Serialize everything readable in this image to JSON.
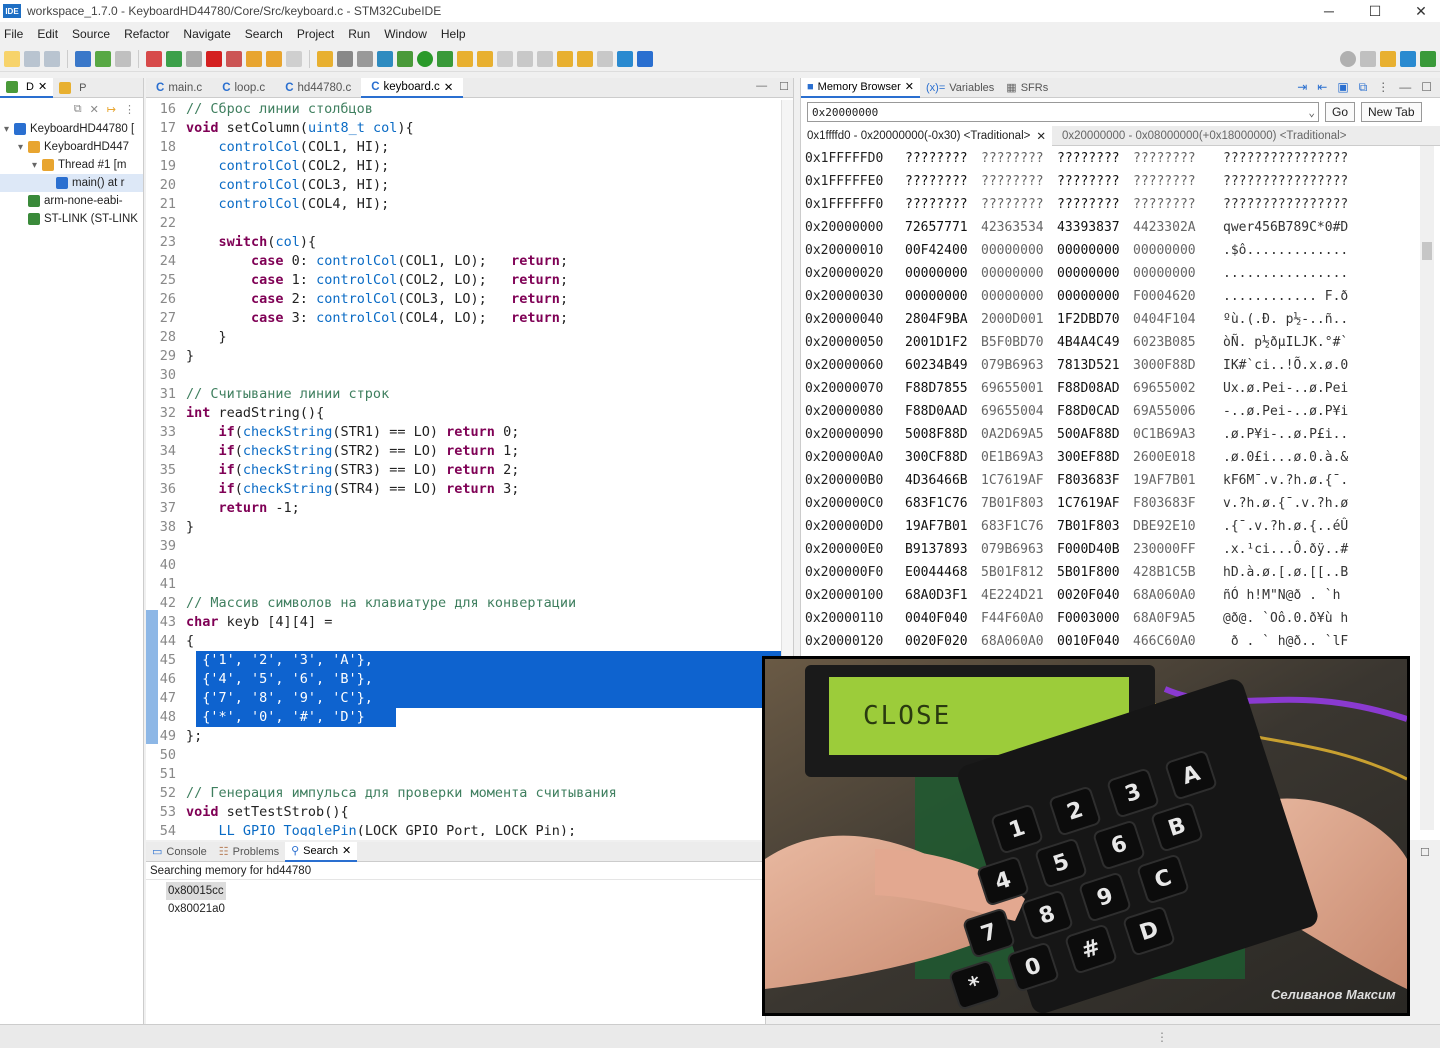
{
  "window": {
    "title": "workspace_1.7.0 - KeyboardHD44780/Core/Src/keyboard.c - STM32CubeIDE",
    "app_icon": "IDE",
    "minimize": "─",
    "maximize": "☐",
    "close": "✕"
  },
  "menu": [
    "File",
    "Edit",
    "Source",
    "Refactor",
    "Navigate",
    "Search",
    "Project",
    "Run",
    "Window",
    "Help"
  ],
  "left_panel": {
    "tabs": [
      {
        "label": "D"
      },
      {
        "label": "P"
      }
    ],
    "tree": [
      {
        "label": "KeyboardHD44780 [",
        "indent": 0
      },
      {
        "label": "KeyboardHD447",
        "indent": 1
      },
      {
        "label": "Thread #1 [m",
        "indent": 2
      },
      {
        "label": "main() at r",
        "indent": 3
      },
      {
        "label": "arm-none-eabi-",
        "indent": 1
      },
      {
        "label": "ST-LINK (ST-LINK",
        "indent": 1
      }
    ]
  },
  "editor": {
    "tabs": [
      {
        "label": "main.c",
        "active": false
      },
      {
        "label": "loop.c",
        "active": false
      },
      {
        "label": "hd44780.c",
        "active": false
      },
      {
        "label": "keyboard.c",
        "active": true
      }
    ],
    "lines": [
      {
        "n": "16",
        "text": "// Сброс линии столбцов",
        "type": "comment"
      },
      {
        "n": "17",
        "text": "void setColumn(uint8_t col){",
        "type": "code"
      },
      {
        "n": "18",
        "text": "    controlCol(COL1, HI);",
        "type": "code"
      },
      {
        "n": "19",
        "text": "    controlCol(COL2, HI);",
        "type": "code"
      },
      {
        "n": "20",
        "text": "    controlCol(COL3, HI);",
        "type": "code"
      },
      {
        "n": "21",
        "text": "    controlCol(COL4, HI);",
        "type": "code"
      },
      {
        "n": "22",
        "text": "",
        "type": "code"
      },
      {
        "n": "23",
        "text": "    switch(col){",
        "type": "code"
      },
      {
        "n": "24",
        "text": "        case 0: controlCol(COL1, LO);   return;",
        "type": "code"
      },
      {
        "n": "25",
        "text": "        case 1: controlCol(COL2, LO);   return;",
        "type": "code"
      },
      {
        "n": "26",
        "text": "        case 2: controlCol(COL3, LO);   return;",
        "type": "code"
      },
      {
        "n": "27",
        "text": "        case 3: controlCol(COL4, LO);   return;",
        "type": "code"
      },
      {
        "n": "28",
        "text": "    }",
        "type": "code"
      },
      {
        "n": "29",
        "text": "}",
        "type": "code"
      },
      {
        "n": "30",
        "text": "",
        "type": "code"
      },
      {
        "n": "31",
        "text": "// Считывание линии строк",
        "type": "comment"
      },
      {
        "n": "32",
        "text": "int readString(){",
        "type": "code"
      },
      {
        "n": "33",
        "text": "    if(checkString(STR1) == LO) return 0;",
        "type": "code"
      },
      {
        "n": "34",
        "text": "    if(checkString(STR2) == LO) return 1;",
        "type": "code"
      },
      {
        "n": "35",
        "text": "    if(checkString(STR3) == LO) return 2;",
        "type": "code"
      },
      {
        "n": "36",
        "text": "    if(checkString(STR4) == LO) return 3;",
        "type": "code"
      },
      {
        "n": "37",
        "text": "    return -1;",
        "type": "code"
      },
      {
        "n": "38",
        "text": "}",
        "type": "code"
      },
      {
        "n": "39",
        "text": "",
        "type": "code"
      },
      {
        "n": "40",
        "text": "",
        "type": "code"
      },
      {
        "n": "41",
        "text": "",
        "type": "code"
      },
      {
        "n": "42",
        "text": "// Массив символов на клавиатуре для конвертации",
        "type": "comment"
      },
      {
        "n": "43",
        "text": "char keyb [4][4] =",
        "type": "code"
      },
      {
        "n": "44",
        "text": "{",
        "type": "code"
      },
      {
        "n": "45",
        "text": "  {'1', '2', '3', 'A'},",
        "type": "selected"
      },
      {
        "n": "46",
        "text": "  {'4', '5', '6', 'B'},",
        "type": "selected"
      },
      {
        "n": "47",
        "text": "  {'7', '8', '9', 'C'},",
        "type": "selected"
      },
      {
        "n": "48",
        "text": "  {'*', '0', '#', 'D'}",
        "type": "selected"
      },
      {
        "n": "49",
        "text": "};",
        "type": "code"
      },
      {
        "n": "50",
        "text": "",
        "type": "code"
      },
      {
        "n": "51",
        "text": "",
        "type": "code"
      },
      {
        "n": "52",
        "text": "// Генерация импульса для проверки момента считывания",
        "type": "comment"
      },
      {
        "n": "53",
        "text": "void setTestStrob(){",
        "type": "code"
      },
      {
        "n": "54",
        "text": "    LL_GPIO_TogglePin(LOCK_GPIO_Port, LOCK_Pin);",
        "type": "code"
      }
    ]
  },
  "memory": {
    "tabs": [
      {
        "label": "Memory Browser"
      },
      {
        "label": "Variables"
      },
      {
        "label": "SFRs"
      }
    ],
    "address_input": "0x20000000",
    "go_label": "Go",
    "new_tab_label": "New Tab",
    "rendering_tabs": [
      {
        "label": "0x1ffffd0 - 0x20000000(-0x30) <Traditional>"
      },
      {
        "label": "0x20000000 - 0x08000000(+0x18000000) <Traditional>"
      }
    ],
    "rows": [
      {
        "addr": "0x1FFFFFD0",
        "w": [
          "????????",
          "????????",
          "????????",
          "????????"
        ],
        "ascii": "????????????????"
      },
      {
        "addr": "0x1FFFFFE0",
        "w": [
          "????????",
          "????????",
          "????????",
          "????????"
        ],
        "ascii": "????????????????"
      },
      {
        "addr": "0x1FFFFFF0",
        "w": [
          "????????",
          "????????",
          "????????",
          "????????"
        ],
        "ascii": "????????????????"
      },
      {
        "addr": "0x20000000",
        "w": [
          "72657771",
          "42363534",
          "43393837",
          "4423302A"
        ],
        "ascii": "qwer456B789C*0#D"
      },
      {
        "addr": "0x20000010",
        "w": [
          "00F42400",
          "00000000",
          "00000000",
          "00000000"
        ],
        "ascii": ".$ô............."
      },
      {
        "addr": "0x20000020",
        "w": [
          "00000000",
          "00000000",
          "00000000",
          "00000000"
        ],
        "ascii": "................"
      },
      {
        "addr": "0x20000030",
        "w": [
          "00000000",
          "00000000",
          "00000000",
          "F0004620"
        ],
        "ascii": "............ F.ð"
      },
      {
        "addr": "0x20000040",
        "w": [
          "2804F9BA",
          "2000D001",
          "1F2DBD70",
          "0404F104"
        ],
        "ascii": "ºù.(.Ð. p½-..ñ.."
      },
      {
        "addr": "0x20000050",
        "w": [
          "2001D1F2",
          "B5F0BD70",
          "4B4A4C49",
          "6023B085"
        ],
        "ascii": "òÑ. p½ðµILJK.°#`"
      },
      {
        "addr": "0x20000060",
        "w": [
          "60234B49",
          "079B6963",
          "7813D521",
          "3000F88D"
        ],
        "ascii": "IK#`ci..!Õ.x.ø.0"
      },
      {
        "addr": "0x20000070",
        "w": [
          "F88D7855",
          "69655001",
          "F88D08AD",
          "69655002"
        ],
        "ascii": "Ux.ø.Pei-..ø.Pei"
      },
      {
        "addr": "0x20000080",
        "w": [
          "F88D0AAD",
          "69655004",
          "F88D0CAD",
          "69A55006"
        ],
        "ascii": "-..ø.Pei-..ø.P¥i"
      },
      {
        "addr": "0x20000090",
        "w": [
          "5008F88D",
          "0A2D69A5",
          "500AF88D",
          "0C1B69A3"
        ],
        "ascii": ".ø.P¥i-..ø.P£i.."
      },
      {
        "addr": "0x200000A0",
        "w": [
          "300CF88D",
          "0E1B69A3",
          "300EF88D",
          "2600E018"
        ],
        "ascii": ".ø.0£i...ø.0.à.&"
      },
      {
        "addr": "0x200000B0",
        "w": [
          "4D36466B",
          "1C7619AF",
          "F803683F",
          "19AF7B01"
        ],
        "ascii": "kF6M¯.v.?h.ø.{¯."
      },
      {
        "addr": "0x200000C0",
        "w": [
          "683F1C76",
          "7B01F803",
          "1C7619AF",
          "F803683F"
        ],
        "ascii": "v.?h.ø.{¯.v.?h.ø"
      },
      {
        "addr": "0x200000D0",
        "w": [
          "19AF7B01",
          "683F1C76",
          "7B01F803",
          "DBE92E10"
        ],
        "ascii": ".{¯.v.?h.ø.{..éÛ"
      },
      {
        "addr": "0x200000E0",
        "w": [
          "B9137893",
          "079B6963",
          "F000D40B",
          "230000FF"
        ],
        "ascii": ".x.¹ci...Ô.ðÿ..#"
      },
      {
        "addr": "0x200000F0",
        "w": [
          "E0044468",
          "5B01F812",
          "5B01F800",
          "428B1C5B"
        ],
        "ascii": "hD.à.ø.[.ø.[[..B"
      },
      {
        "addr": "0x20000100",
        "w": [
          "68A0D3F1",
          "4E224D21",
          "0020F040",
          "68A060A0"
        ],
        "ascii": "ñÓ h!M\"N@ð . `h"
      },
      {
        "addr": "0x20000110",
        "w": [
          "0040F040",
          "F44F60A0",
          "F0003000",
          "68A0F9A5"
        ],
        "ascii": "@ð@. `Oô.0.ð¥ù h"
      },
      {
        "addr": "0x20000120",
        "w": [
          "0020F020",
          "68A060A0",
          "0010F040",
          "466C60A0"
        ],
        "ascii": " ð . ` h@ð.. `lF"
      }
    ]
  },
  "console": {
    "tabs": [
      {
        "label": "Console"
      },
      {
        "label": "Problems"
      },
      {
        "label": "Search"
      }
    ],
    "status": "Searching memory for hd44780",
    "results": [
      "0x80015cc",
      "0x80021a0"
    ]
  },
  "video": {
    "lcd_text": "CLOSE",
    "watermark": "Селиванов Максим",
    "keys": [
      "1",
      "2",
      "3",
      "A",
      "4",
      "5",
      "6",
      "B",
      "7",
      "8",
      "9",
      "C",
      "*",
      "0",
      "#",
      "D"
    ]
  },
  "colors": {
    "selection": "#0e63cf",
    "keyword": "#7f0055",
    "comment": "#3f7f5f",
    "function": "#0a6bc5",
    "lcd": "#9ccc3a"
  }
}
